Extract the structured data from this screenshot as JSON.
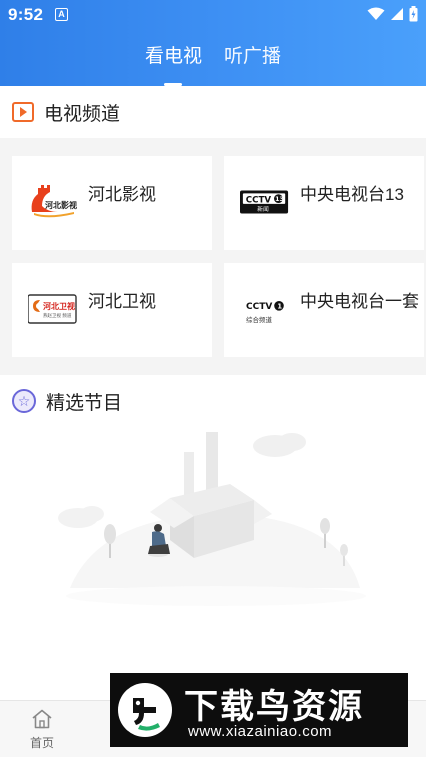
{
  "status_bar": {
    "time": "9:52",
    "notif_icon_letter": "A"
  },
  "tabs": [
    {
      "label": "看电视",
      "active": true
    },
    {
      "label": "听广播",
      "active": false
    }
  ],
  "tv_section": {
    "title": "电视频道",
    "channels": [
      {
        "name": "河北影视",
        "logo_text": "河北影视",
        "logo_icon": "hebei-yingshi-logo"
      },
      {
        "name": "中央电视台13",
        "logo_text": "CCTV13 新闻",
        "logo_icon": "cctv13-logo"
      },
      {
        "name": "河北卫视",
        "logo_text": "河北卫视",
        "logo_icon": "hebei-weishi-logo"
      },
      {
        "name": "中央电视台一套",
        "logo_text": "CCTV1 综合频道",
        "logo_icon": "cctv1-logo"
      }
    ]
  },
  "featured_section": {
    "title": "精选节目",
    "empty_state_icon": "empty-box-illustration"
  },
  "bottom_nav": {
    "home_label": "首页"
  },
  "watermark": {
    "brand": "下载鸟资源",
    "url": "www.xiazainiao.com"
  },
  "colors": {
    "header_start": "#2f7fe8",
    "header_end": "#4aa0fb",
    "tv_icon": "#f06a2a",
    "star_icon": "#6a67d9",
    "grid_bg": "#f4f4f4"
  }
}
